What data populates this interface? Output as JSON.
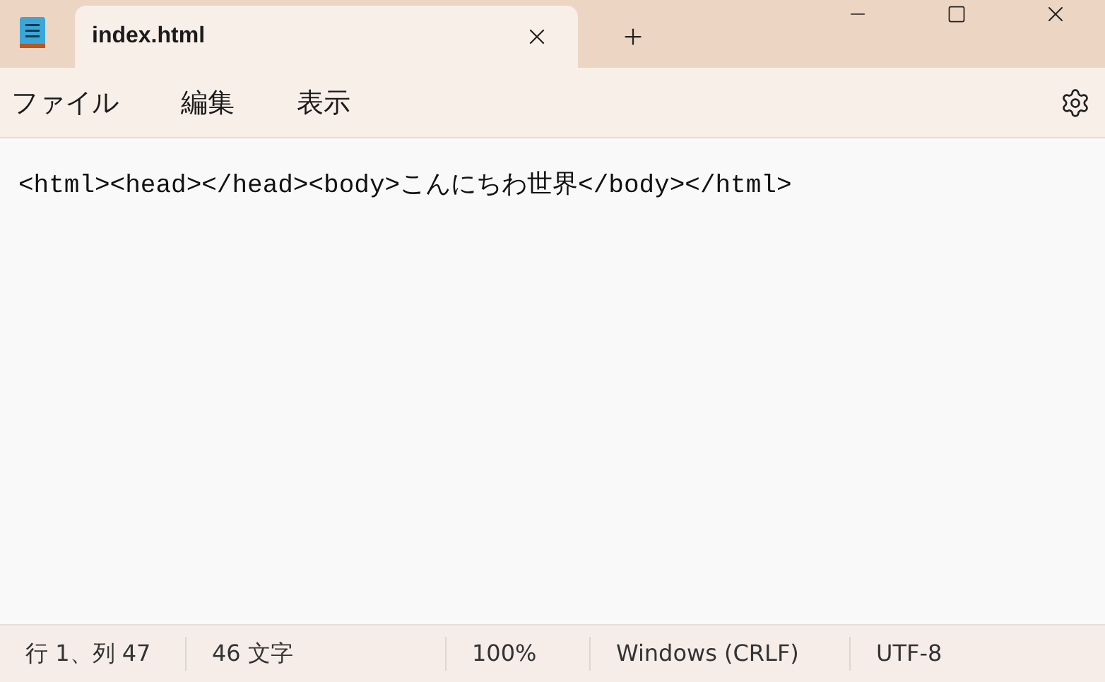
{
  "tabs": [
    {
      "label": "index.html",
      "selected": true
    }
  ],
  "menu": [
    "ファイル",
    "編集",
    "表示"
  ],
  "editor": {
    "content": "<html><head></head><body>こんにちわ世界</body></html>"
  },
  "status_bar": [
    "行 1、列 47",
    "46 文字",
    "100%",
    "Windows (CRLF)",
    "UTF-8"
  ]
}
